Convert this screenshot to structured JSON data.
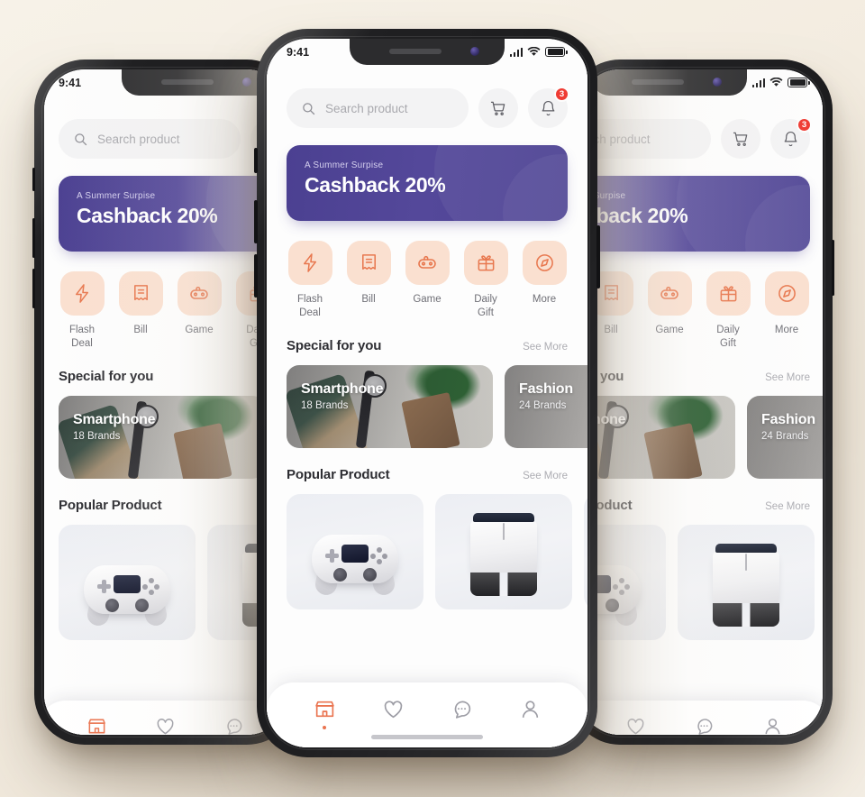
{
  "background": {
    "color_top": "#f7f2e8",
    "color_bottom": "#efe7da"
  },
  "theme": {
    "purple": "#4b4091",
    "coral": "#ea7450",
    "peach": "#fae0d0",
    "badge_red": "#ef3b33",
    "text_dark": "#2e2e33",
    "text_muted": "#acacb2"
  },
  "status_bar": {
    "time": "9:41",
    "signal_icon": "signal-bars-icon",
    "wifi_icon": "wifi-icon",
    "battery_icon": "battery-full-icon"
  },
  "top_bar": {
    "search_placeholder": "Search product",
    "search_value": "",
    "search_icon": "search-icon",
    "cart_icon": "shopping-cart-icon",
    "notification_icon": "bell-icon",
    "notification_count": "3"
  },
  "banner": {
    "subtitle": "A Summer Surpise",
    "title": "Cashback 20%"
  },
  "categories": [
    {
      "label": "Flash\nDeal",
      "label_line1": "Flash",
      "label_line2": "Deal",
      "icon": "lightning-bolt-icon"
    },
    {
      "label": "Bill",
      "label_line1": "Bill",
      "label_line2": "",
      "icon": "receipt-icon"
    },
    {
      "label": "Game",
      "label_line1": "Game",
      "label_line2": "",
      "icon": "gamepad-icon"
    },
    {
      "label": "Daily Gift",
      "label_line1": "Daily",
      "label_line2": "Gift",
      "icon": "gift-box-icon"
    },
    {
      "label": "More",
      "label_line1": "More",
      "label_line2": "",
      "icon": "compass-icon"
    }
  ],
  "special_section": {
    "title": "Special for you",
    "see_more": "See More",
    "cards": [
      {
        "name": "Smartphone",
        "brands": "18 Brands",
        "image": "smartphone-flatlay-photo"
      },
      {
        "name": "Fashion",
        "brands": "24 Brands",
        "image": "fashion-leather-flatlay-photo"
      }
    ]
  },
  "popular_section": {
    "title": "Popular Product",
    "see_more": "See More",
    "products": [
      {
        "image": "white-game-controller-photo"
      },
      {
        "image": "white-black-shorts-photo"
      },
      {
        "image": "watermelon-slice-photo"
      }
    ]
  },
  "tab_bar": {
    "items": [
      {
        "icon": "store-icon",
        "active": true
      },
      {
        "icon": "heart-icon",
        "active": false
      },
      {
        "icon": "chat-bubble-icon",
        "active": false
      },
      {
        "icon": "user-profile-icon",
        "active": false
      }
    ]
  }
}
